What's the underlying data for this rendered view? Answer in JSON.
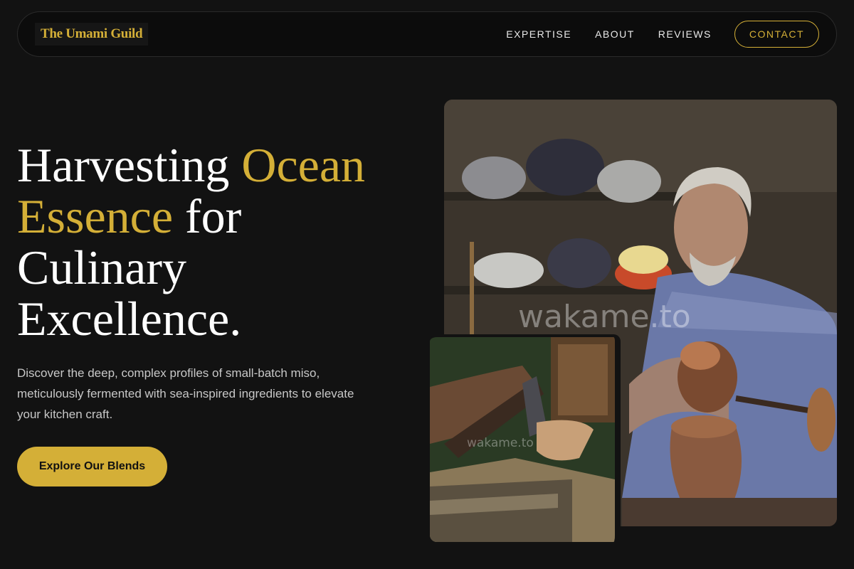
{
  "nav": {
    "logo": "The Umami Guild",
    "links": [
      "EXPERTISE",
      "ABOUT",
      "REVIEWS"
    ],
    "cta": "CONTACT"
  },
  "hero": {
    "title_part1": "Harvesting ",
    "title_gold1": "Ocean",
    "title_gold2": "Essence",
    "title_part2": " for",
    "title_part3": "Culinary",
    "title_part4": "Excellence.",
    "description": "Discover the deep, complex profiles of small-batch miso, meticulously fermented with sea-inspired ingredients to elevate your kitchen craft.",
    "button": "Explore Our Blends"
  },
  "images": {
    "main_watermark": "wakame.to",
    "small_watermark": "wakame.to"
  },
  "colors": {
    "accent": "#d4af37",
    "background": "#121212"
  }
}
